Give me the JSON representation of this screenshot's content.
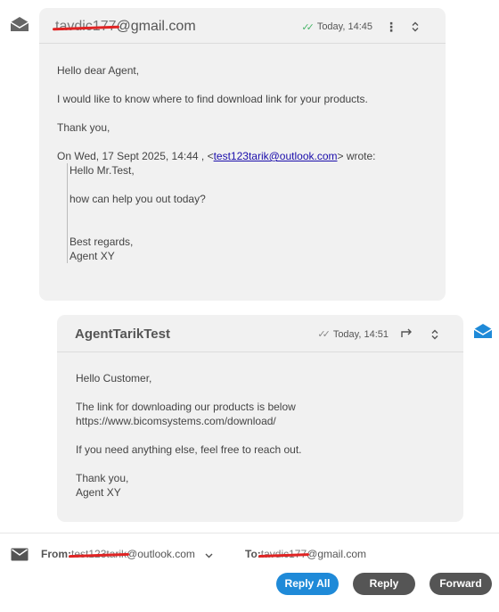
{
  "incoming": {
    "sender_redacted": "tavdic177",
    "sender_domain": "@gmail.com",
    "time": "Today, 14:45",
    "status_icon": "double-check-green",
    "body": {
      "greeting": "Hello dear Agent,",
      "line1": "I would like to know where to find download link for your products.",
      "closing": "Thank you,",
      "quote_intro_prefix": "On Wed, 17 Sept 2025, 14:44 , <",
      "quote_email": "test123tarik@outlook.com",
      "quote_intro_suffix": "> wrote:",
      "quote": {
        "greeting": "Hello Mr.Test,",
        "line1": "how can help you out today?",
        "regards": "Best regards,",
        "signature": "Agent XY"
      }
    }
  },
  "outgoing": {
    "sender": "AgentTarikTest",
    "time": "Today, 14:51",
    "status_icon": "double-check-grey",
    "body": {
      "greeting": "Hello Customer,",
      "line1": "The link for downloading our products is below",
      "link": "https://www.bicomsystems.com/download/",
      "line2": "If you need anything else, feel free to reach out.",
      "closing": "Thank you,",
      "signature": "Agent XY"
    }
  },
  "footer": {
    "from_label": "From:",
    "from_redacted": "test123tarik",
    "from_domain": "@outlook.com",
    "to_label": "To:",
    "to_redacted": "tavdic177",
    "to_domain": "@gmail.com",
    "reply_all": "Reply All",
    "reply": "Reply",
    "forward": "Forward"
  },
  "colors": {
    "card_bg": "#f1f1f1",
    "primary_button": "#1f8ad8",
    "secondary_button": "#555555",
    "out_icon": "#1f8ad8",
    "redaction": "#e02424"
  }
}
